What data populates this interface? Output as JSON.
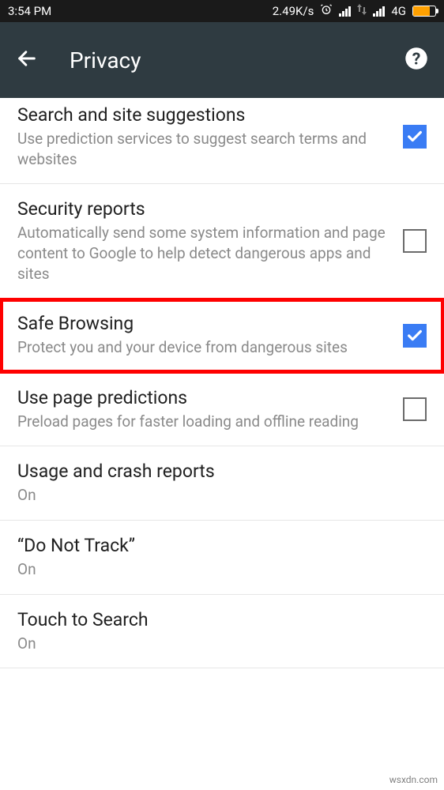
{
  "status": {
    "time": "3:54 PM",
    "speed": "2.49K/s",
    "network": "4G"
  },
  "header": {
    "title": "Privacy"
  },
  "settings": [
    {
      "title": "Search and site suggestions",
      "desc": "Use prediction services to suggest search terms and websites",
      "checked": true,
      "hasCheckbox": true,
      "highlight": false,
      "first": true
    },
    {
      "title": "Security reports",
      "desc": "Automatically send some system information and page content to Google to help detect dangerous apps and sites",
      "checked": false,
      "hasCheckbox": true,
      "highlight": false
    },
    {
      "title": "Safe Browsing",
      "desc": "Protect you and your device from dangerous sites",
      "checked": true,
      "hasCheckbox": true,
      "highlight": true
    },
    {
      "title": "Use page predictions",
      "desc": "Preload pages for faster loading and offline reading",
      "checked": false,
      "hasCheckbox": true,
      "highlight": false
    },
    {
      "title": "Usage and crash reports",
      "desc": "On",
      "hasCheckbox": false,
      "highlight": false
    },
    {
      "title": "“Do Not Track”",
      "desc": "On",
      "hasCheckbox": false,
      "highlight": false
    },
    {
      "title": "Touch to Search",
      "desc": "On",
      "hasCheckbox": false,
      "highlight": false
    }
  ],
  "watermark": "wsxdn.com"
}
